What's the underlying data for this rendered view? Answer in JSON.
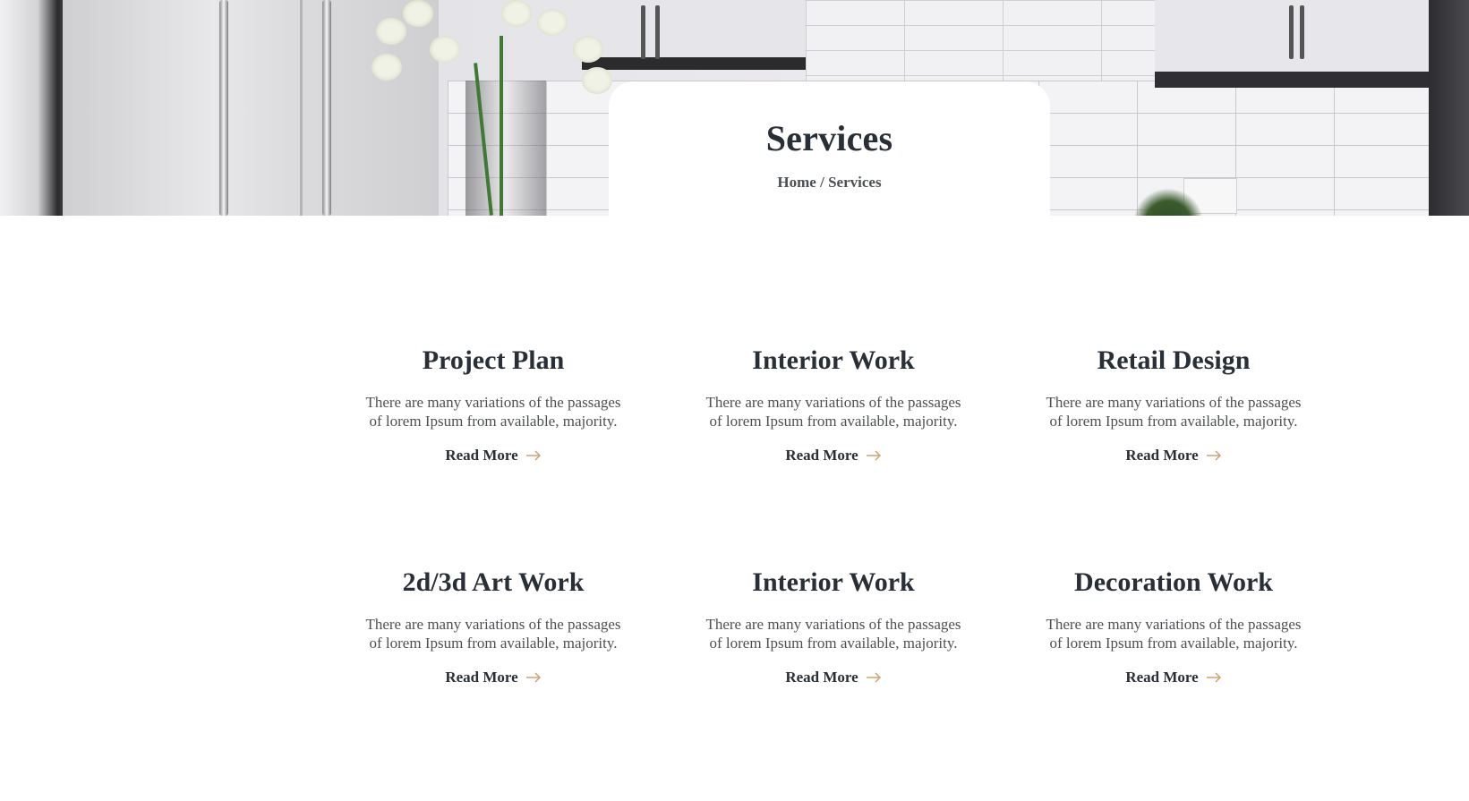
{
  "hero": {
    "title": "Services",
    "breadcrumb": {
      "home": "Home",
      "separator": " / ",
      "current": "Services"
    }
  },
  "services": [
    {
      "title": "Project Plan",
      "description": "There are many variations of the passages of lorem Ipsum from available, majority.",
      "link": "Read More"
    },
    {
      "title": "Interior Work",
      "description": "There are many variations of the passages of lorem Ipsum from available, majority.",
      "link": "Read More"
    },
    {
      "title": "Retail Design",
      "description": "There are many variations of the passages of lorem Ipsum from available, majority.",
      "link": "Read More"
    },
    {
      "title": "2d/3d Art Work",
      "description": "There are many variations of the passages of lorem Ipsum from available, majority.",
      "link": "Read More"
    },
    {
      "title": "Interior Work",
      "description": "There are many variations of the passages of lorem Ipsum from available, majority.",
      "link": "Read More"
    },
    {
      "title": "Decoration Work",
      "description": "There are many variations of the passages of lorem Ipsum from available, majority.",
      "link": "Read More"
    }
  ],
  "colors": {
    "heading": "#292f36",
    "body_text": "#4d5053",
    "accent_arrow": "#cda274",
    "background": "#ffffff"
  },
  "icons": {
    "read_more": "arrow-right-icon"
  }
}
